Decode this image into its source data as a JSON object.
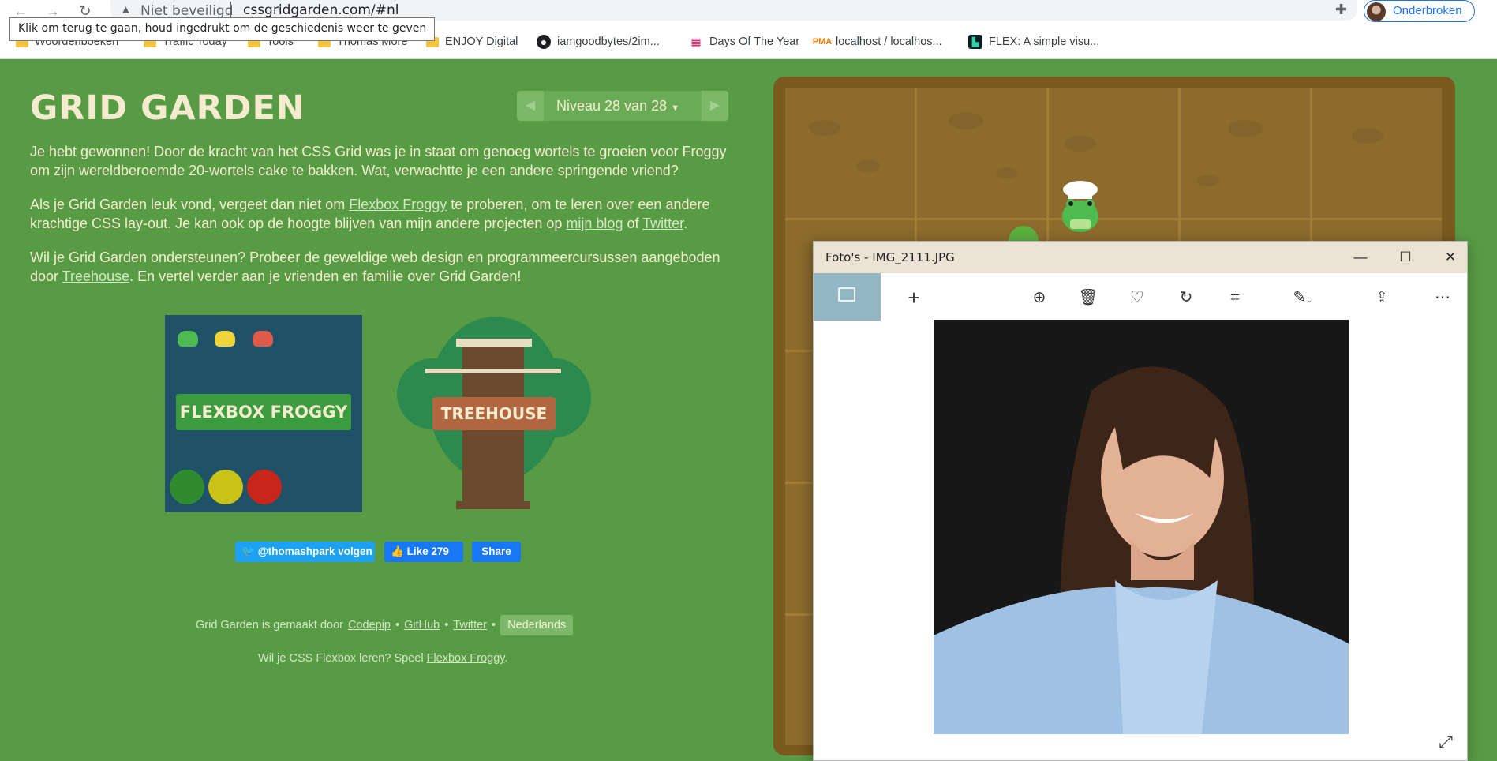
{
  "browser": {
    "address": {
      "security_label": "Niet beveiligd",
      "url": "cssgridgarden.com/#nl"
    },
    "tooltip": "Klik om terug te gaan, houd ingedrukt om de geschiedenis weer te geven",
    "profile_label": "Onderbroken",
    "bookmarks": [
      {
        "label": "Woordenboeken",
        "icon": "folder-icon"
      },
      {
        "label": "Traffic Today",
        "icon": "folder-icon"
      },
      {
        "label": "Tools",
        "icon": "folder-icon"
      },
      {
        "label": "Thomas More",
        "icon": "folder-icon"
      },
      {
        "label": "ENJOY Digital",
        "icon": "folder-icon"
      },
      {
        "label": "iamgoodbytes/2im...",
        "icon": "github-icon"
      },
      {
        "label": "Days Of The Year",
        "icon": "calendar-icon"
      },
      {
        "label": "localhost / localhos...",
        "icon": "phpmyadmin-icon"
      },
      {
        "label": "FLEX: A simple visu...",
        "icon": "flex-icon"
      }
    ]
  },
  "page": {
    "title": "GRID GARDEN",
    "level_label": "Niveau 28 van 28",
    "para1": "Je hebt gewonnen! Door de kracht van het CSS Grid was je in staat om genoeg wortels te groeien voor Froggy om zijn wereldberoemde 20-wortels cake te bakken. Wat, verwachtte je een andere springende vriend?",
    "para2": {
      "t1": "Als je Grid Garden leuk vond, vergeet dan niet om ",
      "link1": "Flexbox Froggy",
      "t2": " te proberen, om te leren over een andere krachtige CSS lay-out. Je kan ook op de hoogte blijven van mijn andere projecten op ",
      "link2": "mijn blog",
      "t3": " of ",
      "link3": "Twitter",
      "t4": "."
    },
    "para3": {
      "t1": "Wil je Grid Garden ondersteunen? Probeer de geweldige web design en programmeercursussen aangeboden door ",
      "link1": "Treehouse",
      "t2": ". En vertel verder aan je vrienden en familie over Grid Garden!"
    },
    "froggy_card_label": "FLEXBOX FROGGY",
    "treehouse_card_label": "TREEHOUSE",
    "social": {
      "twitter_follow": "@thomashpark volgen",
      "fb_like": "Like 279",
      "fb_share": "Share"
    },
    "footer": {
      "made_by": "Grid Garden is gemaakt door",
      "codepip": "Codepip",
      "github": "GitHub",
      "twitter": "Twitter",
      "bullet": "•",
      "language": "Nederlands",
      "learn_prefix": "Wil je CSS Flexbox leren? Speel",
      "learn_link": "Flexbox Froggy",
      "learn_suffix": "."
    }
  },
  "photos_app": {
    "title": "Foto's - IMG_2111.JPG",
    "toolbar": [
      "add-icon",
      "zoom-icon",
      "delete-icon",
      "favorite-icon",
      "rotate-icon",
      "crop-icon",
      "edit-icon",
      "share-icon",
      "more-icon"
    ]
  },
  "colors": {
    "page_bg": "#589b45",
    "title_text": "#f5ecd0",
    "garden_border": "#7a5a1e",
    "soil": "#8d6b2d",
    "titlebar": "#ece3d4",
    "gallery_accent": "#93b6c5"
  }
}
